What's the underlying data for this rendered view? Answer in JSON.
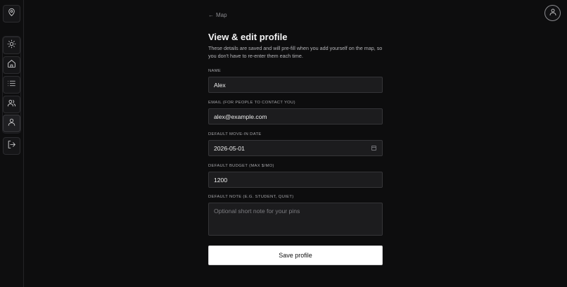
{
  "nav": {
    "top_icon": "map-pin-icon",
    "items": [
      {
        "icon": "sun-icon",
        "active": false
      },
      {
        "icon": "home-icon",
        "active": false
      },
      {
        "icon": "list-icon",
        "active": false
      },
      {
        "icon": "users-icon",
        "active": false
      },
      {
        "icon": "user-icon",
        "active": true
      }
    ],
    "bottom_icon": "logout-icon"
  },
  "header": {
    "back_arrow": "←",
    "back_label": "Map",
    "account_icon": "user-circle-icon"
  },
  "profile": {
    "title": "View & edit profile",
    "description": "These details are saved and will pre-fill when you add yourself on the map, so you don't have to re-enter them each time.",
    "fields": {
      "name": {
        "label": "Name",
        "value": "Alex"
      },
      "email": {
        "label": "Email (for people to contact you)",
        "value": "alex@example.com"
      },
      "move_in": {
        "label": "Default move-in date",
        "value": "2026-05-01"
      },
      "budget": {
        "label": "Default budget (max $/mo)",
        "value": "1200"
      },
      "note": {
        "label": "Default note (e.g. student, quiet)",
        "value": "",
        "placeholder": "Optional short note for your pins"
      }
    },
    "save_label": "Save profile"
  },
  "colors": {
    "background": "#0d0d0e",
    "field_bg": "#1c1c1e",
    "button_bg": "#ffffff"
  }
}
